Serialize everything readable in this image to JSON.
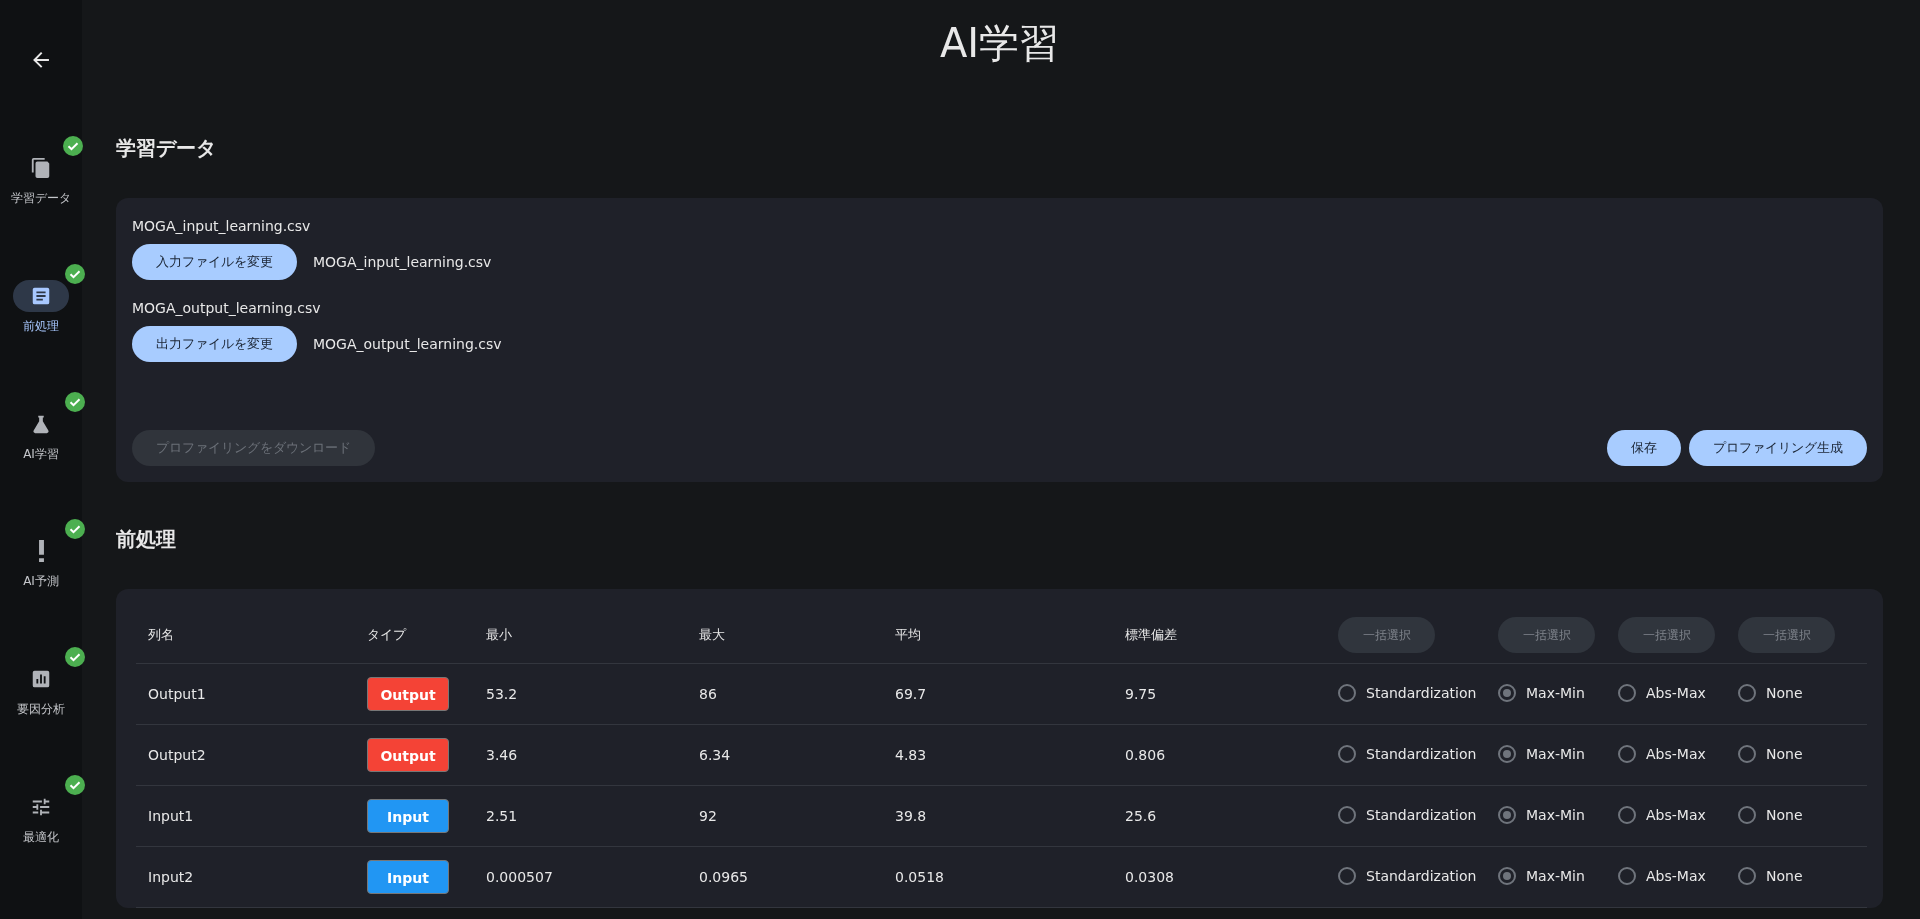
{
  "page_title": "AI学習",
  "sidebar": {
    "items": [
      {
        "label": "学習データ",
        "selected": false,
        "done": true
      },
      {
        "label": "前処理",
        "selected": true,
        "done": true
      },
      {
        "label": "AI学習",
        "selected": false,
        "done": true
      },
      {
        "label": "AI予測",
        "selected": false,
        "done": true
      },
      {
        "label": "要因分析",
        "selected": false,
        "done": true
      },
      {
        "label": "最適化",
        "selected": false,
        "done": true
      }
    ]
  },
  "learning_data": {
    "heading": "学習データ",
    "files": [
      {
        "label": "MOGA_input_learning.csv",
        "button": "入力ファイルを変更",
        "filename": "MOGA_input_learning.csv"
      },
      {
        "label": "MOGA_output_learning.csv",
        "button": "出力ファイルを変更",
        "filename": "MOGA_output_learning.csv"
      }
    ],
    "download_button": {
      "label": "プロファイリングをダウンロード",
      "disabled": true
    },
    "actions": [
      "保存",
      "プロファイリング生成"
    ]
  },
  "preprocessing": {
    "heading": "前処理",
    "columns": [
      "列名",
      "タイプ",
      "最小",
      "最大",
      "平均",
      "標準偏差"
    ],
    "bulk_buttons": [
      "一括選択",
      "一括選択",
      "一括選択",
      "一括選択"
    ],
    "rows": [
      {
        "name": "Output1",
        "type": {
          "kind": "output",
          "label": "Output"
        },
        "min": "53.2",
        "max": "86",
        "mean": "69.7",
        "std": "9.75",
        "options": [
          {
            "label": "Standardization",
            "selected": false
          },
          {
            "label": "Max-Min",
            "selected": true
          },
          {
            "label": "Abs-Max",
            "selected": false
          },
          {
            "label": "None",
            "selected": false
          }
        ]
      },
      {
        "name": "Output2",
        "type": {
          "kind": "output",
          "label": "Output"
        },
        "min": "3.46",
        "max": "6.34",
        "mean": "4.83",
        "std": "0.806",
        "options": [
          {
            "label": "Standardization",
            "selected": false
          },
          {
            "label": "Max-Min",
            "selected": true
          },
          {
            "label": "Abs-Max",
            "selected": false
          },
          {
            "label": "None",
            "selected": false
          }
        ]
      },
      {
        "name": "Input1",
        "type": {
          "kind": "input",
          "label": "Input"
        },
        "min": "2.51",
        "max": "92",
        "mean": "39.8",
        "std": "25.6",
        "options": [
          {
            "label": "Standardization",
            "selected": false
          },
          {
            "label": "Max-Min",
            "selected": true
          },
          {
            "label": "Abs-Max",
            "selected": false
          },
          {
            "label": "None",
            "selected": false
          }
        ]
      },
      {
        "name": "Input2",
        "type": {
          "kind": "input",
          "label": "Input"
        },
        "min": "0.000507",
        "max": "0.0965",
        "mean": "0.0518",
        "std": "0.0308",
        "options": [
          {
            "label": "Standardization",
            "selected": false
          },
          {
            "label": "Max-Min",
            "selected": true
          },
          {
            "label": "Abs-Max",
            "selected": false
          },
          {
            "label": "None",
            "selected": false
          }
        ]
      }
    ]
  }
}
